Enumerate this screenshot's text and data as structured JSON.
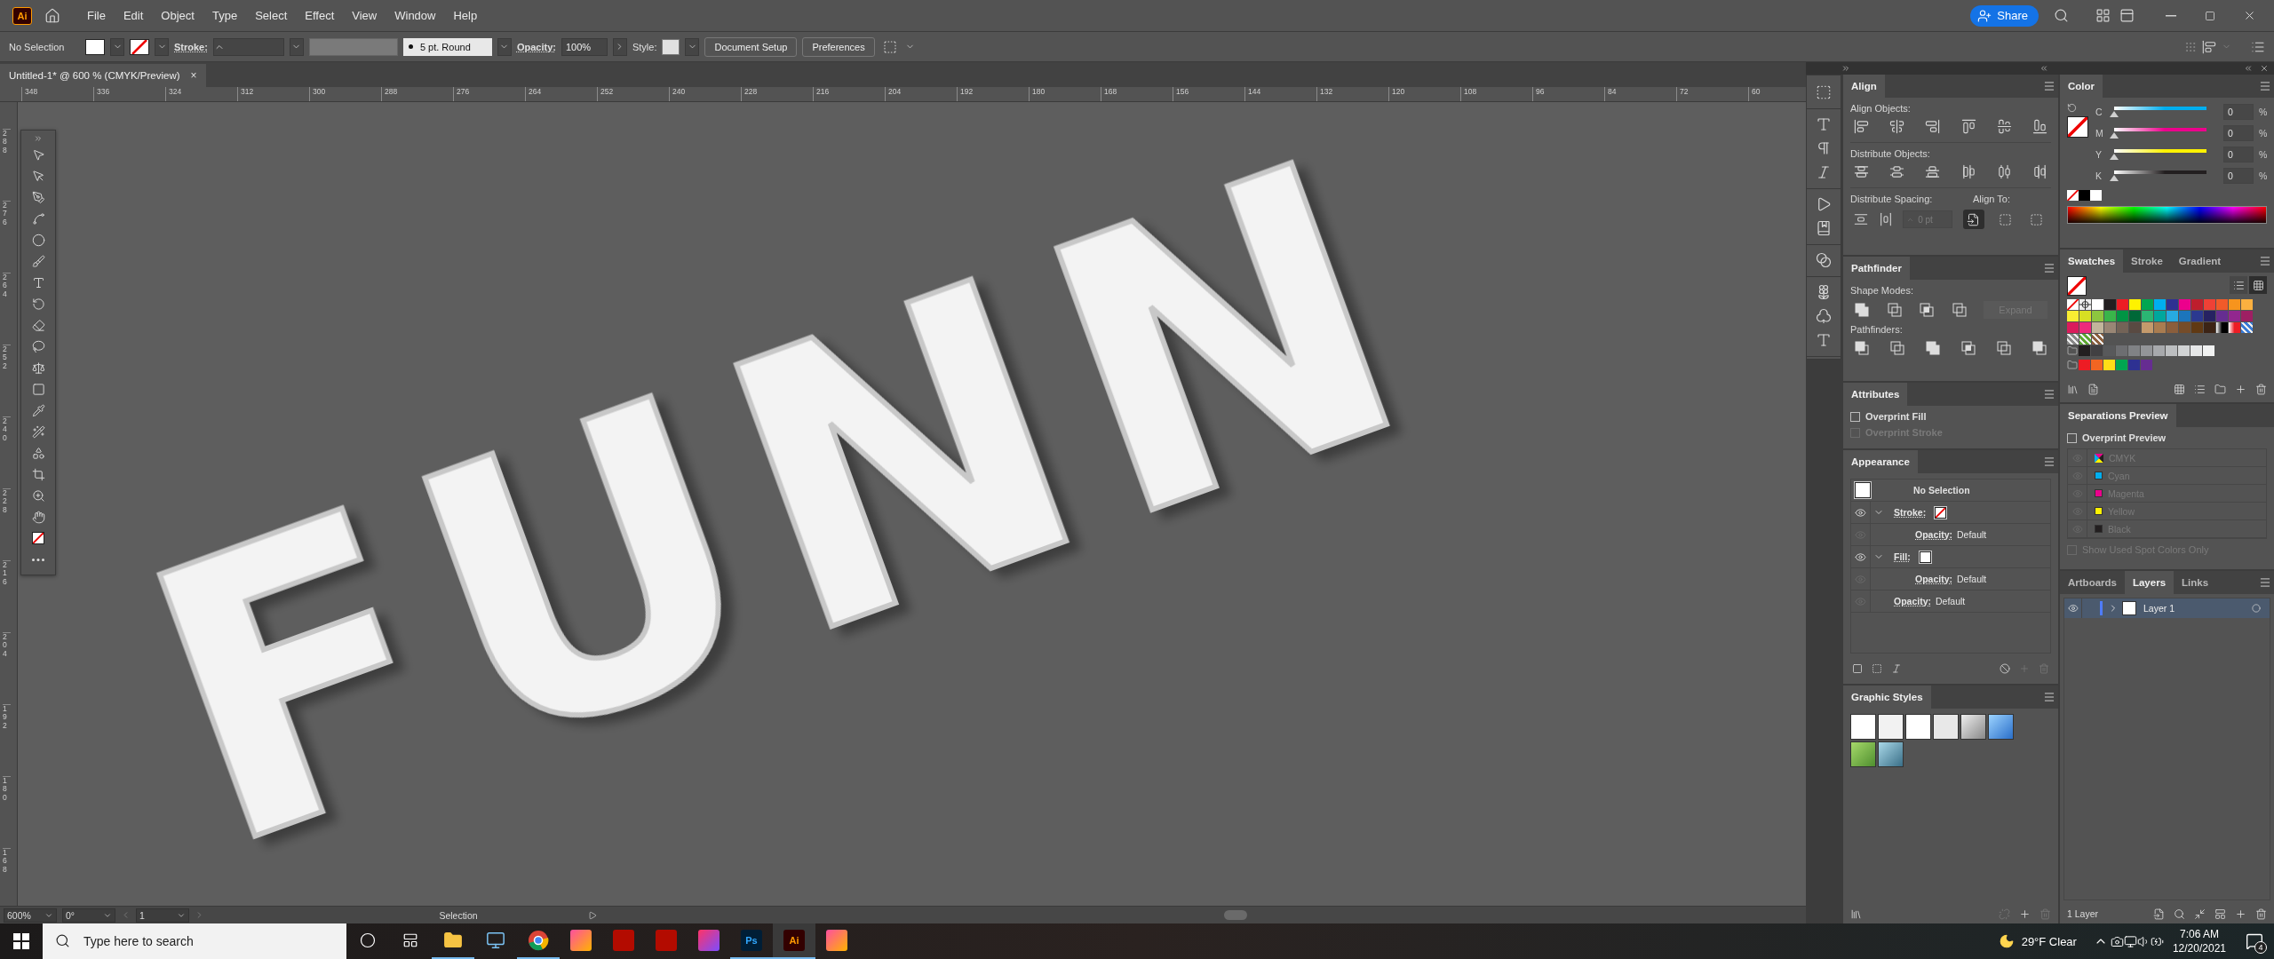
{
  "menu_bar": {
    "app_logo": "Ai",
    "items": [
      "File",
      "Edit",
      "Object",
      "Type",
      "Select",
      "Effect",
      "View",
      "Window",
      "Help"
    ],
    "share_button": "Share"
  },
  "control_bar": {
    "selection": "No Selection",
    "stroke_label": "Stroke:",
    "brush": "5 pt. Round",
    "opacity_label": "Opacity:",
    "opacity_value": "100%",
    "style_label": "Style:",
    "buttons": [
      "Document Setup",
      "Preferences"
    ]
  },
  "document_tab": {
    "title": "Untitled-1* @ 600 % (CMYK/Preview)",
    "close": "×"
  },
  "ruler": {
    "horizontal": [
      "348",
      "336",
      "324",
      "312",
      "300",
      "288",
      "276",
      "264",
      "252",
      "240",
      "228",
      "216",
      "204",
      "192",
      "180",
      "168",
      "156",
      "144",
      "132",
      "120",
      "108",
      "96",
      "84",
      "72",
      "60"
    ],
    "vertical": [
      "288",
      "276",
      "264",
      "252",
      "240",
      "228",
      "216",
      "204",
      "192",
      "180",
      "168"
    ]
  },
  "canvas": {
    "artwork_text": "FUNN"
  },
  "align": {
    "title": "Align",
    "align_objects": "Align Objects:",
    "distribute_objects": "Distribute Objects:",
    "distribute_spacing": "Distribute Spacing:",
    "spacing_value": "0 pt",
    "align_to": "Align To:",
    "align_to_options": [
      {
        "selected": true
      },
      {
        "selected": false
      },
      {
        "selected": false
      }
    ]
  },
  "pathfinder": {
    "title": "Pathfinder",
    "shape_modes": "Shape Modes:",
    "expand_button": "Expand",
    "pathfinders": "Pathfinders:"
  },
  "attributes": {
    "title": "Attributes",
    "options": [
      {
        "label": "Overprint Fill",
        "checked": false,
        "disabled": false
      },
      {
        "label": "Overprint Stroke",
        "checked": false,
        "disabled": true
      }
    ]
  },
  "appearance": {
    "title": "Appearance",
    "header": "No Selection",
    "items": [
      {
        "kind": "stroke",
        "label": "Stroke:",
        "visible": true,
        "expanded": true,
        "children": [
          {
            "kind": "opacity",
            "label": "Opacity:",
            "value": "Default",
            "visible": false
          }
        ]
      },
      {
        "kind": "fill",
        "label": "Fill:",
        "visible": true,
        "expanded": true,
        "children": [
          {
            "kind": "opacity",
            "label": "Opacity:",
            "value": "Default",
            "visible": false
          }
        ]
      },
      {
        "kind": "opacity",
        "label": "Opacity:",
        "value": "Default",
        "visible": false
      }
    ]
  },
  "graphic_styles": {
    "title": "Graphic Styles"
  },
  "color": {
    "title": "Color",
    "channels": [
      {
        "label": "C",
        "value": "0",
        "unit": "%",
        "level": 0,
        "color": "#00aeef"
      },
      {
        "label": "M",
        "value": "0",
        "unit": "%",
        "level": 0,
        "color": "#ec008c"
      },
      {
        "label": "Y",
        "value": "0",
        "unit": "%",
        "level": 0,
        "color": "#fff200"
      },
      {
        "label": "K",
        "value": "0",
        "unit": "%",
        "level": 0,
        "color": "#231f20"
      }
    ]
  },
  "swatches": {
    "tabs": [
      {
        "label": "Swatches",
        "selected": true
      },
      {
        "label": "Stroke",
        "selected": false
      },
      {
        "label": "Gradient",
        "selected": false
      }
    ],
    "rows": [
      [
        {
          "kind": "none"
        },
        {
          "kind": "registration"
        },
        {
          "kind": "color",
          "color": "#ffffff"
        },
        {
          "kind": "color",
          "color": "#231f20"
        },
        {
          "kind": "color",
          "color": "#ed1c24"
        },
        {
          "kind": "color",
          "color": "#fff200"
        },
        {
          "kind": "color",
          "color": "#00a651"
        },
        {
          "kind": "color",
          "color": "#00aeef"
        },
        {
          "kind": "color",
          "color": "#2e3192"
        },
        {
          "kind": "color",
          "color": "#ec008c"
        },
        {
          "kind": "color",
          "color": "#be1e2d"
        },
        {
          "kind": "color",
          "color": "#ef4136"
        },
        {
          "kind": "color",
          "color": "#f15a29"
        },
        {
          "kind": "color",
          "color": "#f7941d"
        },
        {
          "kind": "color",
          "color": "#fbb040"
        }
      ],
      [
        {
          "kind": "color",
          "color": "#f9ed32"
        },
        {
          "kind": "color",
          "color": "#d7df23"
        },
        {
          "kind": "color",
          "color": "#8dc63f"
        },
        {
          "kind": "color",
          "color": "#39b54a"
        },
        {
          "kind": "color",
          "color": "#009444"
        },
        {
          "kind": "color",
          "color": "#006838"
        },
        {
          "kind": "color",
          "color": "#2bb673"
        },
        {
          "kind": "color",
          "color": "#00a79d"
        },
        {
          "kind": "color",
          "color": "#27aae1"
        },
        {
          "kind": "color",
          "color": "#1c75bc"
        },
        {
          "kind": "color",
          "color": "#2b3990"
        },
        {
          "kind": "color",
          "color": "#262262"
        },
        {
          "kind": "color",
          "color": "#662d91"
        },
        {
          "kind": "color",
          "color": "#92278f"
        },
        {
          "kind": "color",
          "color": "#9e1f63"
        }
      ],
      [
        {
          "kind": "color",
          "color": "#da1c5c"
        },
        {
          "kind": "color",
          "color": "#ee2a7b"
        },
        {
          "kind": "color",
          "color": "#c2b59b"
        },
        {
          "kind": "color",
          "color": "#998675"
        },
        {
          "kind": "color",
          "color": "#736357"
        },
        {
          "kind": "color",
          "color": "#594a42"
        },
        {
          "kind": "color",
          "color": "#c49a6c"
        },
        {
          "kind": "color",
          "color": "#a97c50"
        },
        {
          "kind": "color",
          "color": "#8b5e3c"
        },
        {
          "kind": "color",
          "color": "#754c29"
        },
        {
          "kind": "color",
          "color": "#603913"
        },
        {
          "kind": "color",
          "color": "#3c2415"
        },
        {
          "kind": "gradient",
          "color": "#000000"
        },
        {
          "kind": "gradient",
          "color": "#ed1c24"
        },
        {
          "kind": "pattern",
          "color": "#3a7bd5"
        }
      ],
      [
        {
          "kind": "pattern",
          "color": "#888888"
        },
        {
          "kind": "pattern",
          "color": "#5da832"
        },
        {
          "kind": "pattern",
          "color": "#8b5e3c"
        }
      ],
      [
        {
          "kind": "folder"
        },
        {
          "kind": "color",
          "color": "#231f20"
        },
        {
          "kind": "color",
          "color": "#414042"
        },
        {
          "kind": "color",
          "color": "#58595b"
        },
        {
          "kind": "color",
          "color": "#6d6e71"
        },
        {
          "kind": "color",
          "color": "#808285"
        },
        {
          "kind": "color",
          "color": "#939598"
        },
        {
          "kind": "color",
          "color": "#a7a9ac"
        },
        {
          "kind": "color",
          "color": "#bcbec0"
        },
        {
          "kind": "color",
          "color": "#d1d3d4"
        },
        {
          "kind": "color",
          "color": "#e6e7e8"
        },
        {
          "kind": "color",
          "color": "#f1f2f2"
        }
      ],
      [
        {
          "kind": "folder"
        },
        {
          "kind": "color",
          "color": "#ed1c24"
        },
        {
          "kind": "color",
          "color": "#f26522"
        },
        {
          "kind": "color",
          "color": "#ffde17"
        },
        {
          "kind": "color",
          "color": "#00a651"
        },
        {
          "kind": "color",
          "color": "#2e3192"
        },
        {
          "kind": "color",
          "color": "#662d91"
        }
      ]
    ]
  },
  "separations": {
    "title": "Separations Preview",
    "overprint_preview": {
      "label": "Overprint Preview",
      "checked": false
    },
    "plates": [
      {
        "kind": "process",
        "label": "CMYK",
        "disabled": true
      },
      {
        "kind": "ink",
        "label": "Cyan",
        "color": "#00aeef",
        "disabled": true
      },
      {
        "kind": "ink",
        "label": "Magenta",
        "color": "#ec008c",
        "disabled": true
      },
      {
        "kind": "ink",
        "label": "Yellow",
        "color": "#fff200",
        "disabled": true
      },
      {
        "kind": "ink",
        "label": "Black",
        "color": "#231f20",
        "disabled": true
      }
    ],
    "spot_only": {
      "label": "Show Used Spot Colors Only",
      "checked": false,
      "disabled": true
    }
  },
  "layers": {
    "tabs": [
      {
        "label": "Artboards",
        "selected": false
      },
      {
        "label": "Layers",
        "selected": true
      },
      {
        "label": "Links",
        "selected": false
      }
    ],
    "items": [
      {
        "name": "Layer 1",
        "selected": true,
        "expanded": false,
        "visible": true
      }
    ],
    "count": "1 Layer"
  },
  "status_bar": {
    "zoom": "600%",
    "rotation": "0°",
    "artboard": "1",
    "tool": "Selection"
  },
  "taskbar": {
    "search_placeholder": "Type here to search",
    "apps": [
      {
        "kind": "explorer",
        "running": true,
        "active": false
      },
      {
        "kind": "network",
        "running": false,
        "active": false
      },
      {
        "kind": "chrome",
        "running": true,
        "active": false
      },
      {
        "kind": "tile",
        "running": false,
        "active": false
      },
      {
        "kind": "acrobat",
        "running": false,
        "active": false
      },
      {
        "kind": "acrobat",
        "running": false,
        "active": false
      },
      {
        "kind": "creative",
        "running": false,
        "active": false
      },
      {
        "kind": "photoshop",
        "label": "Ps",
        "running": true,
        "active": false
      },
      {
        "kind": "illustrator",
        "label": "Ai",
        "running": true,
        "active": true
      },
      {
        "kind": "tile",
        "running": false,
        "active": false
      }
    ],
    "weather": "29°F Clear",
    "time": "7:06 AM",
    "date": "12/20/2021",
    "notifications": "4"
  }
}
